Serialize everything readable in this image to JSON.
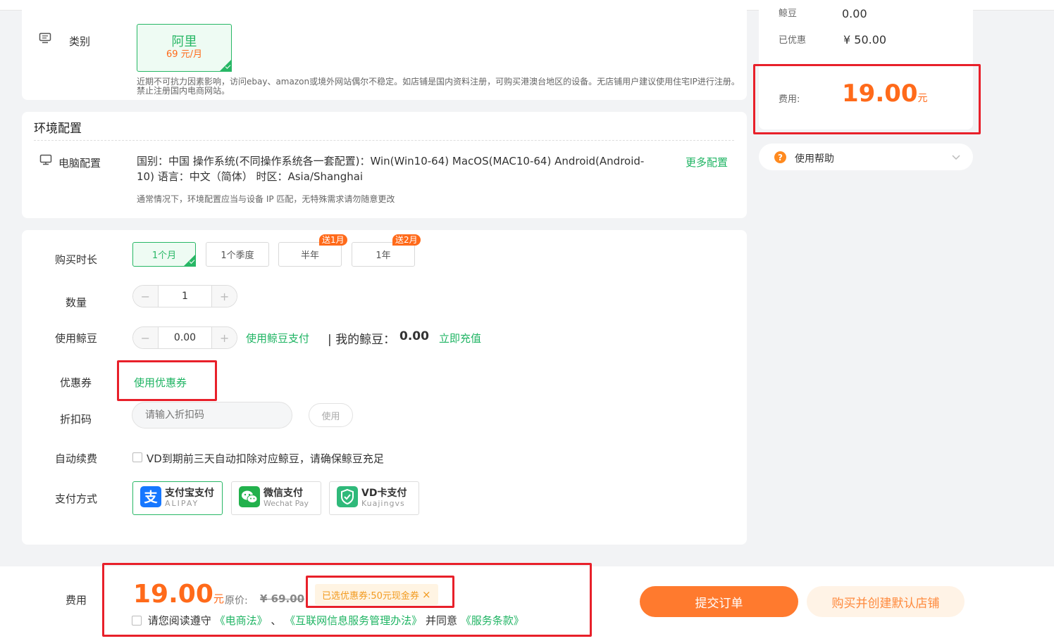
{
  "category_card": {
    "label": "类别",
    "option_name": "阿里",
    "option_price": "69 元/月",
    "note": "近期不可抗力因素影响，访问ebay、amazon或境外网站偶尔不稳定。如店铺是国内资料注册，可购买港澳台地区的设备。无店铺用户建议使用住宅IP进行注册。禁止注册国内电商网站。"
  },
  "env_card": {
    "title": "环境配置",
    "label": "电脑配置",
    "line1": "国别：中国  操作系统(不同操作系统各一套配置)：Win(Win10-64) MacOS(MAC10-64) Android(Android-",
    "line2": "10)  语言：中文（简体）  时区：Asia/Shanghai",
    "more_link": "更多配置",
    "hint": "通常情况下，环境配置应当与设备 IP 匹配，无特殊需求请勿随意更改"
  },
  "purchase": {
    "duration_label": "购买时长",
    "durations": [
      "1个月",
      "1个季度",
      "半年",
      "1年"
    ],
    "badges": [
      "送1月",
      "送2月"
    ],
    "quantity_label": "数量",
    "quantity_value": "1",
    "beans_label": "使用鲸豆",
    "beans_value": "0.00",
    "beans_pay_link": "使用鲸豆支付",
    "my_beans_label": "| 我的鲸豆：",
    "my_beans_value": "0.00",
    "recharge_link": "立即充值",
    "coupon_label": "优惠券",
    "coupon_link": "使用优惠券",
    "discount_label": "折扣码",
    "discount_placeholder": "请输入折扣码",
    "discount_use": "使用",
    "auto_renew_label": "自动续费",
    "auto_renew_text": "VD到期前三天自动扣除对应鲸豆，请确保鲸豆充足",
    "pay_label": "支付方式",
    "pay_methods": [
      {
        "name": "支付宝支付",
        "sub": "ALIPAY",
        "icon": "alipay-icon"
      },
      {
        "name": "微信支付",
        "sub": "Wechat Pay",
        "icon": "wechat-icon"
      },
      {
        "name": "VD卡支付",
        "sub": "Kuajingvs",
        "icon": "vd-shield-icon"
      }
    ]
  },
  "summary": {
    "beans_label": "鲸豆",
    "beans_value": "0.00",
    "discount_label": "已优惠",
    "discount_value": "¥ 50.00",
    "fee_label": "费用:",
    "fee_value": "19.00",
    "fee_unit": "元",
    "help_label": "使用帮助",
    "help_icon_glyph": "?"
  },
  "bottom_bar": {
    "fee_label": "费用",
    "price": "19.00",
    "unit": "元",
    "orig_label": "原价:",
    "orig_value": "¥ 69.00",
    "coupon_tag": "已选优惠券:50元现金券",
    "close_glyph": "×",
    "agree_prefix": "请您阅读遵守",
    "law1": "《电商法》",
    "sep": "、",
    "law2": "《互联网信息服务管理办法》",
    "agree_mid": "并同意",
    "law3": "《服务条款》",
    "submit": "提交订单",
    "buy_create": "购买并创建默认店铺"
  },
  "colors": {
    "accent_green": "#1fb463",
    "accent_orange": "#ff6a1a",
    "highlight_red": "#e8202a"
  }
}
